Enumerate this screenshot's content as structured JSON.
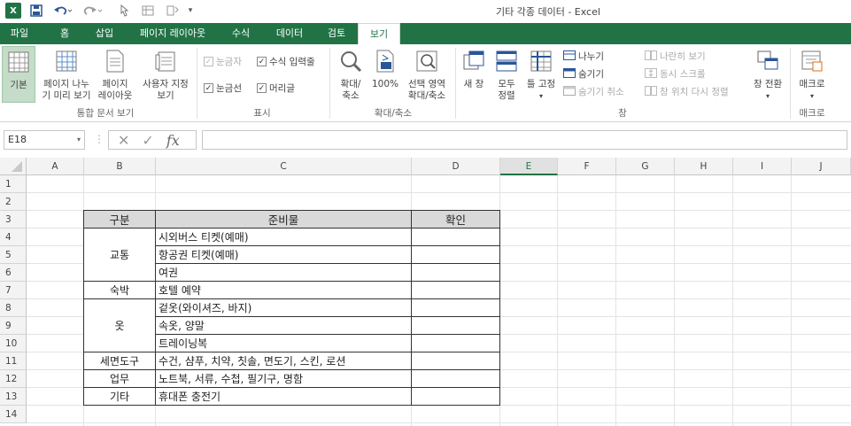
{
  "titlebar": {
    "app_icon": "X",
    "title": "기타 각종 데이터 - Excel",
    "quick_access": [
      "save-icon",
      "undo-icon",
      "redo-icon",
      "touch-mode-icon",
      "form-icon",
      "sort-icon",
      "customize-icon"
    ]
  },
  "tabs": [
    "파일",
    "홈",
    "삽입",
    "페이지 레이아웃",
    "수식",
    "데이터",
    "검토",
    "보기"
  ],
  "active_tab": "보기",
  "ribbon": {
    "workbook_views": {
      "normal": "기본",
      "page_break": "페이지 나누기 미리 보기",
      "page_break_l1": "페이지 나누",
      "page_break_l2": "기 미리 보기",
      "page_layout_l1": "페이지",
      "page_layout_l2": "레이아웃",
      "custom_l1": "사용자 지정",
      "custom_l2": "보기",
      "label": "통합 문서 보기"
    },
    "show": {
      "ruler": "눈금자",
      "formula_bar": "수식 입력줄",
      "gridlines": "눈금선",
      "headings": "머리글",
      "label": "표시"
    },
    "zoom": {
      "zoom_l1": "확대/",
      "zoom_l2": "축소",
      "hundred": "100%",
      "selection_l1": "선택 영역",
      "selection_l2": "확대/축소",
      "label": "확대/축소"
    },
    "window": {
      "new_window": "새 창",
      "arrange_l1": "모두",
      "arrange_l2": "정렬",
      "freeze": "틀 고정",
      "split": "나누기",
      "hide": "숨기기",
      "unhide": "숨기기 취소",
      "side_by_side": "나란히 보기",
      "sync_scroll": "동시 스크롤",
      "reset_position": "창 위치 다시 정렬",
      "switch": "창 전환",
      "label": "창"
    },
    "macros": {
      "macro": "매크로",
      "label": "매크로"
    }
  },
  "formula_bar": {
    "name_box": "E18",
    "formula": ""
  },
  "columns": [
    "A",
    "B",
    "C",
    "D",
    "E",
    "F",
    "G",
    "H",
    "I",
    "J"
  ],
  "selected_column": "E",
  "rows": [
    "1",
    "2",
    "3",
    "4",
    "5",
    "6",
    "7",
    "8",
    "9",
    "10",
    "11",
    "12",
    "13",
    "14"
  ],
  "table": {
    "headers": [
      "구분",
      "준비물",
      "확인"
    ],
    "groups": [
      {
        "category": "교통",
        "items": [
          "시외버스 티켓(예매)",
          "항공권 티켓(예매)",
          "여권"
        ]
      },
      {
        "category": "숙박",
        "items": [
          "호텔 예약"
        ]
      },
      {
        "category": "옷",
        "items": [
          "겉옷(와이셔즈, 바지)",
          "속옷, 양말",
          "트레이닝복"
        ]
      },
      {
        "category": "세면도구",
        "items": [
          "수건, 샴푸, 치약, 칫솔, 면도기, 스킨, 로션"
        ]
      },
      {
        "category": "업무",
        "items": [
          "노트북, 서류, 수첩, 필기구, 명함"
        ]
      },
      {
        "category": "기타",
        "items": [
          "휴대폰 충전기"
        ]
      }
    ]
  },
  "colors": {
    "accent": "#217346",
    "header_fill": "#d9d9d9"
  }
}
